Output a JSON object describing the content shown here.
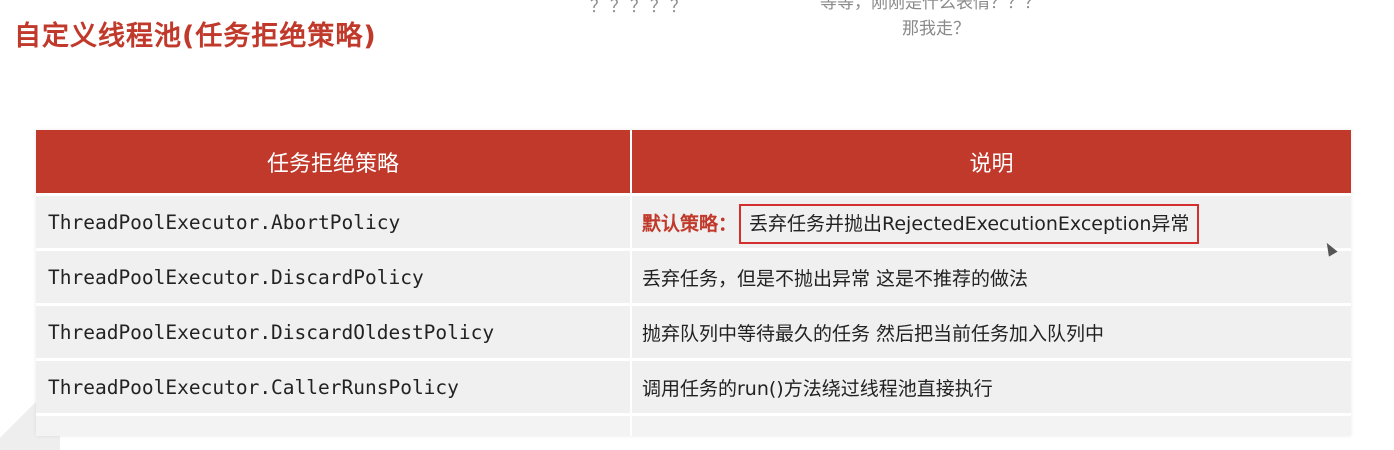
{
  "slide": {
    "title": "自定义线程池(任务拒绝策略)"
  },
  "danmaku": [
    "？？？？？",
    "等等，刚刚是什么表情？？？",
    "那我走？"
  ],
  "table": {
    "headers": [
      "任务拒绝策略",
      "说明"
    ],
    "rows": [
      {
        "policy": "ThreadPoolExecutor.AbortPolicy",
        "label": "默认策略：",
        "desc": "丢弃任务并抛出RejectedExecutionException异常"
      },
      {
        "policy": "ThreadPoolExecutor.DiscardPolicy",
        "label": "",
        "desc": "丢弃任务，但是不抛出异常 这是不推荐的做法"
      },
      {
        "policy": "ThreadPoolExecutor.DiscardOldestPolicy",
        "label": "",
        "desc": "抛弃队列中等待最久的任务 然后把当前任务加入队列中"
      },
      {
        "policy": "ThreadPoolExecutor.CallerRunsPolicy",
        "label": "",
        "desc": "调用任务的run()方法绕过线程池直接执行"
      }
    ]
  },
  "colors": {
    "accent": "#c0392b",
    "row_bg": "#f0f0f0",
    "highlight_border": "#d32f2f"
  },
  "icons": {
    "cursor": "mouse-pointer-icon"
  }
}
